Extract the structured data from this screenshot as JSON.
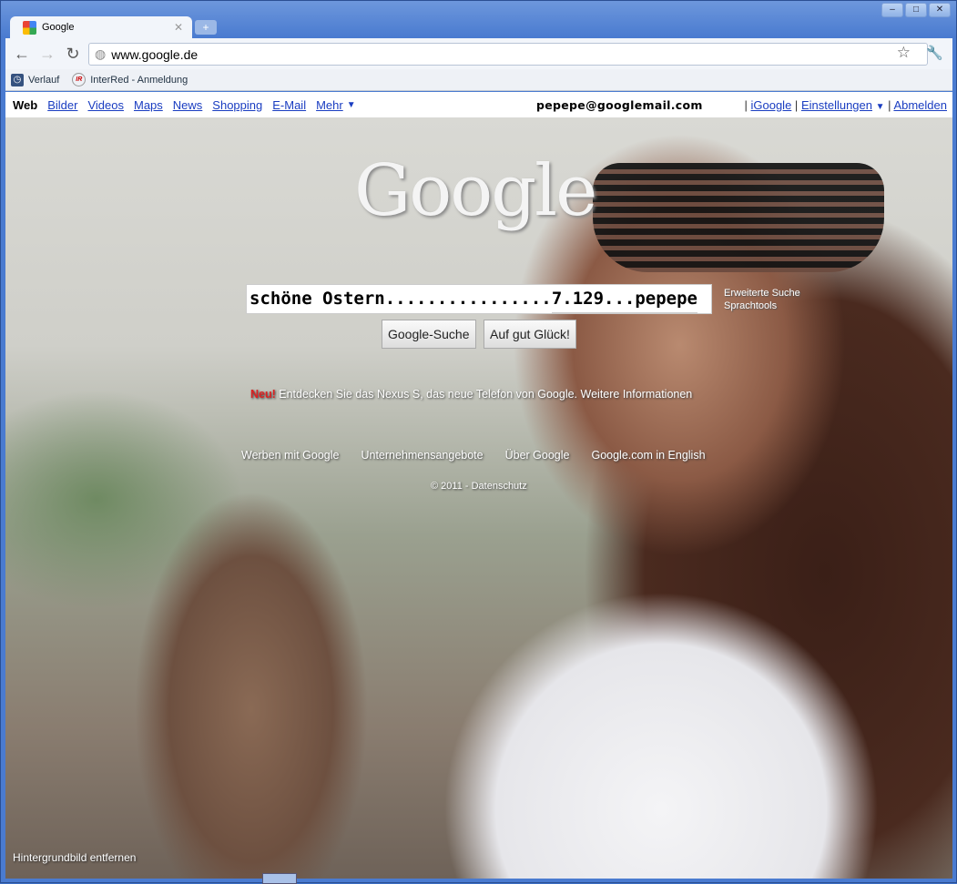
{
  "browser": {
    "tab_title": "Google",
    "url": "www.google.de",
    "window_buttons": [
      "minimize",
      "maximize",
      "close"
    ],
    "bookmarks": [
      {
        "label": "Verlauf",
        "icon": "clock-icon"
      },
      {
        "label": "InterRed - Anmeldung",
        "icon": "interred-icon"
      }
    ]
  },
  "gbar": {
    "active": "Web",
    "links": [
      "Bilder",
      "Videos",
      "Maps",
      "News",
      "Shopping",
      "E-Mail",
      "Mehr"
    ],
    "more_arrow": "▼",
    "email": "pepepe@googlemail.com",
    "igoogle": "iGoogle",
    "settings": "Einstellungen",
    "signout": "Abmelden",
    "sep": "|"
  },
  "main": {
    "logo": "Google",
    "search_value_left": "schöne Ostern................",
    "search_value_right": "7.129...pepepe",
    "advanced": "Erweiterte Suche",
    "language_tools": "Sprachtools",
    "search_button": "Google-Suche",
    "lucky_button": "Auf gut Glück!",
    "promo_new": "Neu!",
    "promo_text": "Entdecken Sie das Nexus S, das neue Telefon von Google.",
    "promo_link": "Weitere Informationen",
    "footer_links": [
      "Werben mit Google",
      "Unternehmensangebote",
      "Über Google",
      "Google.com in English"
    ],
    "copyright": "© 2011 - Datenschutz",
    "remove_background": "Hintergrundbild entfernen"
  }
}
